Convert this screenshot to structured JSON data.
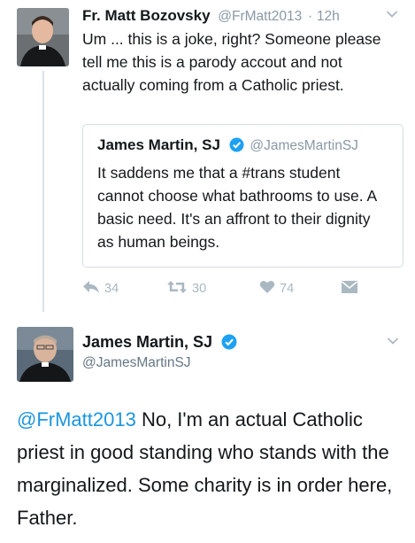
{
  "tweet_original": {
    "author_name": "Fr. Matt Bozovsky",
    "author_handle": "@FrMatt2013",
    "separator": "·",
    "time": "12h",
    "body": "Um ... this is a joke, right? Someone please tell me this is a parody accout and not actually coming from a Catholic priest.",
    "quoted": {
      "author_name": "James Martin, SJ",
      "author_handle": "@JamesMartinSJ",
      "body": "It saddens me that a #trans student cannot choose what bathrooms to use. A basic need. It's an affront to their dignity as human beings."
    },
    "actions": {
      "reply_count": "34",
      "retweet_count": "30",
      "like_count": "74"
    }
  },
  "tweet_reply": {
    "author_name": "James Martin, SJ",
    "author_handle": "@JamesMartinSJ",
    "mention": "@FrMatt2013",
    "body": " No, I'm an actual Catholic priest in good standing who stands with the marginalized. Some charity is in order here, Father."
  },
  "colors": {
    "link": "#1b95e0",
    "verified": "#1da1f2",
    "muted": "#8899a6",
    "action_icons": "#aab8c2"
  },
  "icons": [
    "chevron-down-icon",
    "verified-badge-icon",
    "reply-icon",
    "retweet-icon",
    "heart-icon",
    "direct-message-icon"
  ]
}
